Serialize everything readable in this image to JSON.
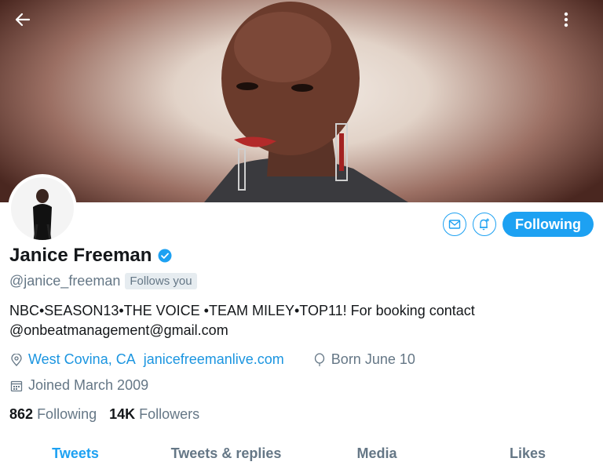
{
  "profile": {
    "name": "Janice Freeman",
    "handle": "@janice_freeman",
    "follows_you": "Follows you",
    "bio_line1": "NBC•SEASON13•THE VOICE •TEAM MILEY•TOP11! For booking contact",
    "bio_line2": "@onbeatmanagement@gmail.com",
    "location": "West Covina, CA",
    "website": "janicefreemanlive.com",
    "born": "Born June 10",
    "joined": "Joined March 2009",
    "following_count": "862",
    "following_label": "Following",
    "followers_count": "14K",
    "followers_label": "Followers"
  },
  "actions": {
    "follow_state": "Following",
    "message_icon": "envelope-icon",
    "notify_icon": "bell-plus-icon"
  },
  "tabs": [
    {
      "label": "Tweets",
      "active": true
    },
    {
      "label": "Tweets & replies",
      "active": false
    },
    {
      "label": "Media",
      "active": false
    },
    {
      "label": "Likes",
      "active": false
    }
  ],
  "colors": {
    "accent": "#1da1f2",
    "link": "#1b95e0",
    "muted": "#657786",
    "text": "#14171a"
  }
}
